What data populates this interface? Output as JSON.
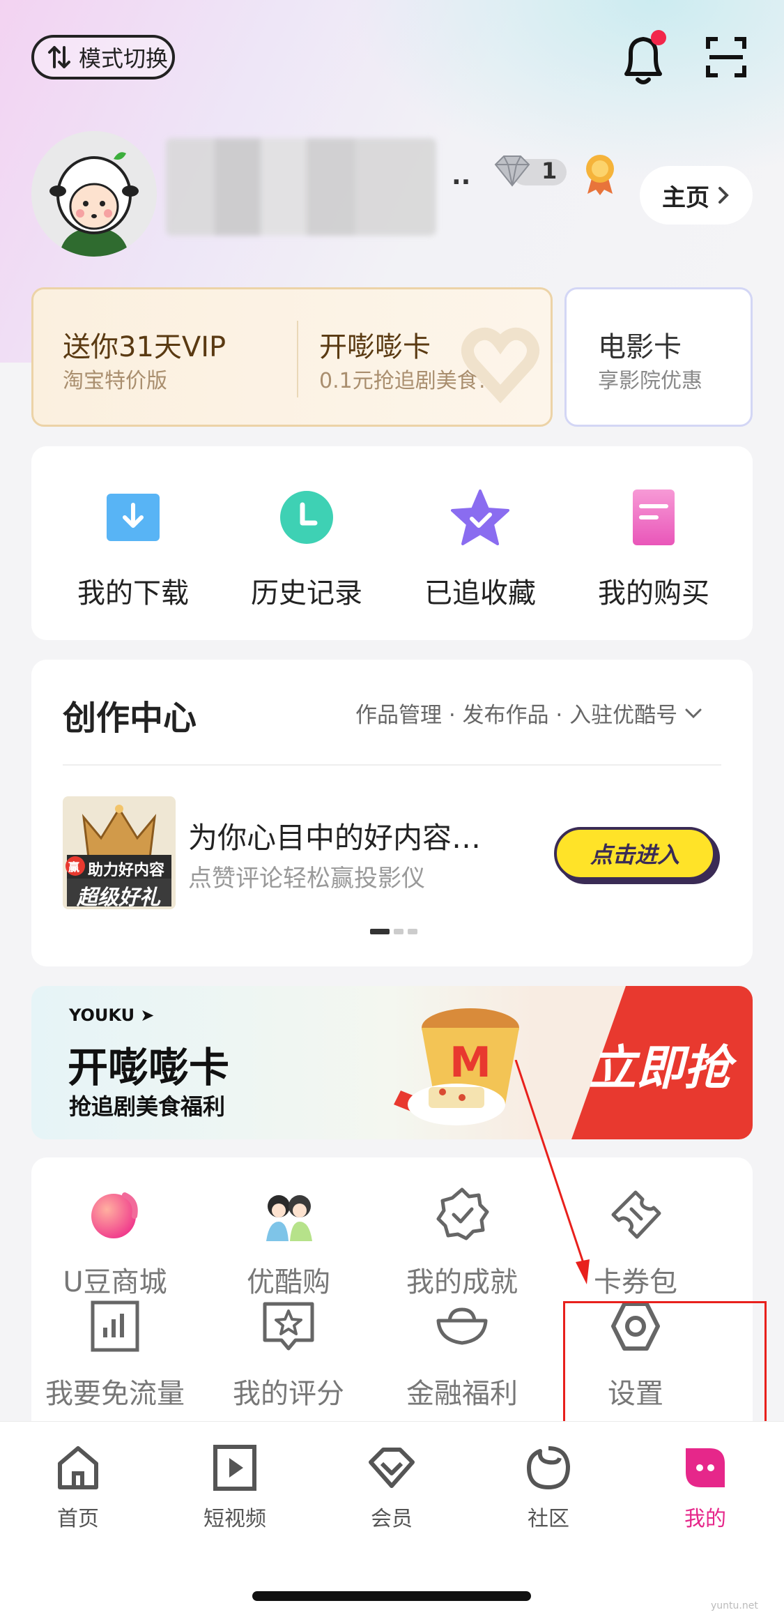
{
  "top_bar": {
    "mode_switch_label": "模式切换"
  },
  "profile": {
    "name_suffix": "..",
    "diamond_count": "1",
    "home_button_label": "主页"
  },
  "promos": [
    {
      "title": "送你31天VIP",
      "subtitle": "淘宝特价版"
    },
    {
      "title": "开嘭嘭卡",
      "subtitle": "0.1元抢追剧美食!"
    },
    {
      "title": "电影卡",
      "subtitle": "享影院优惠"
    }
  ],
  "shortcuts": [
    {
      "label": "我的下载",
      "icon": "download-icon"
    },
    {
      "label": "历史记录",
      "icon": "history-icon"
    },
    {
      "label": "已追收藏",
      "icon": "favorites-icon"
    },
    {
      "label": "我的购买",
      "icon": "purchases-icon"
    }
  ],
  "create_center": {
    "title": "创作中心",
    "links": "作品管理 · 发布作品 · 入驻优酷号",
    "item_title": "为你心目中的好内容…",
    "item_subtitle": "点赞评论轻松赢投影仪",
    "thumb_line1": "助力好内容",
    "thumb_line2": "超级好礼",
    "thumb_badge": "赢",
    "enter_label": "点击进入"
  },
  "banner": {
    "brand": "YOUKU",
    "title": "开嘭嘭卡",
    "subtitle": "抢追剧美食福利",
    "cta": "立即抢"
  },
  "services_row1": [
    {
      "label": "U豆商城",
      "icon": "u-bean-icon"
    },
    {
      "label": "优酷购",
      "icon": "youku-shop-icon"
    },
    {
      "label": "我的成就",
      "icon": "achievement-icon"
    },
    {
      "label": "卡券包",
      "icon": "coupon-icon"
    }
  ],
  "services_row2": [
    {
      "label": "我要免流量",
      "icon": "data-free-icon"
    },
    {
      "label": "我的评分",
      "icon": "rating-icon"
    },
    {
      "label": "金融福利",
      "icon": "finance-icon"
    },
    {
      "label": "设置",
      "icon": "settings-icon"
    }
  ],
  "tab_bar": [
    {
      "label": "首页",
      "icon": "home-icon"
    },
    {
      "label": "短视频",
      "icon": "short-video-icon"
    },
    {
      "label": "会员",
      "icon": "vip-icon"
    },
    {
      "label": "社区",
      "icon": "community-icon"
    },
    {
      "label": "我的",
      "icon": "profile-icon",
      "active": true
    }
  ],
  "colors": {
    "accent": "#e6278a",
    "annotation": "#e8201c",
    "banner_red": "#e8392f"
  },
  "watermark": "yuntu.net"
}
